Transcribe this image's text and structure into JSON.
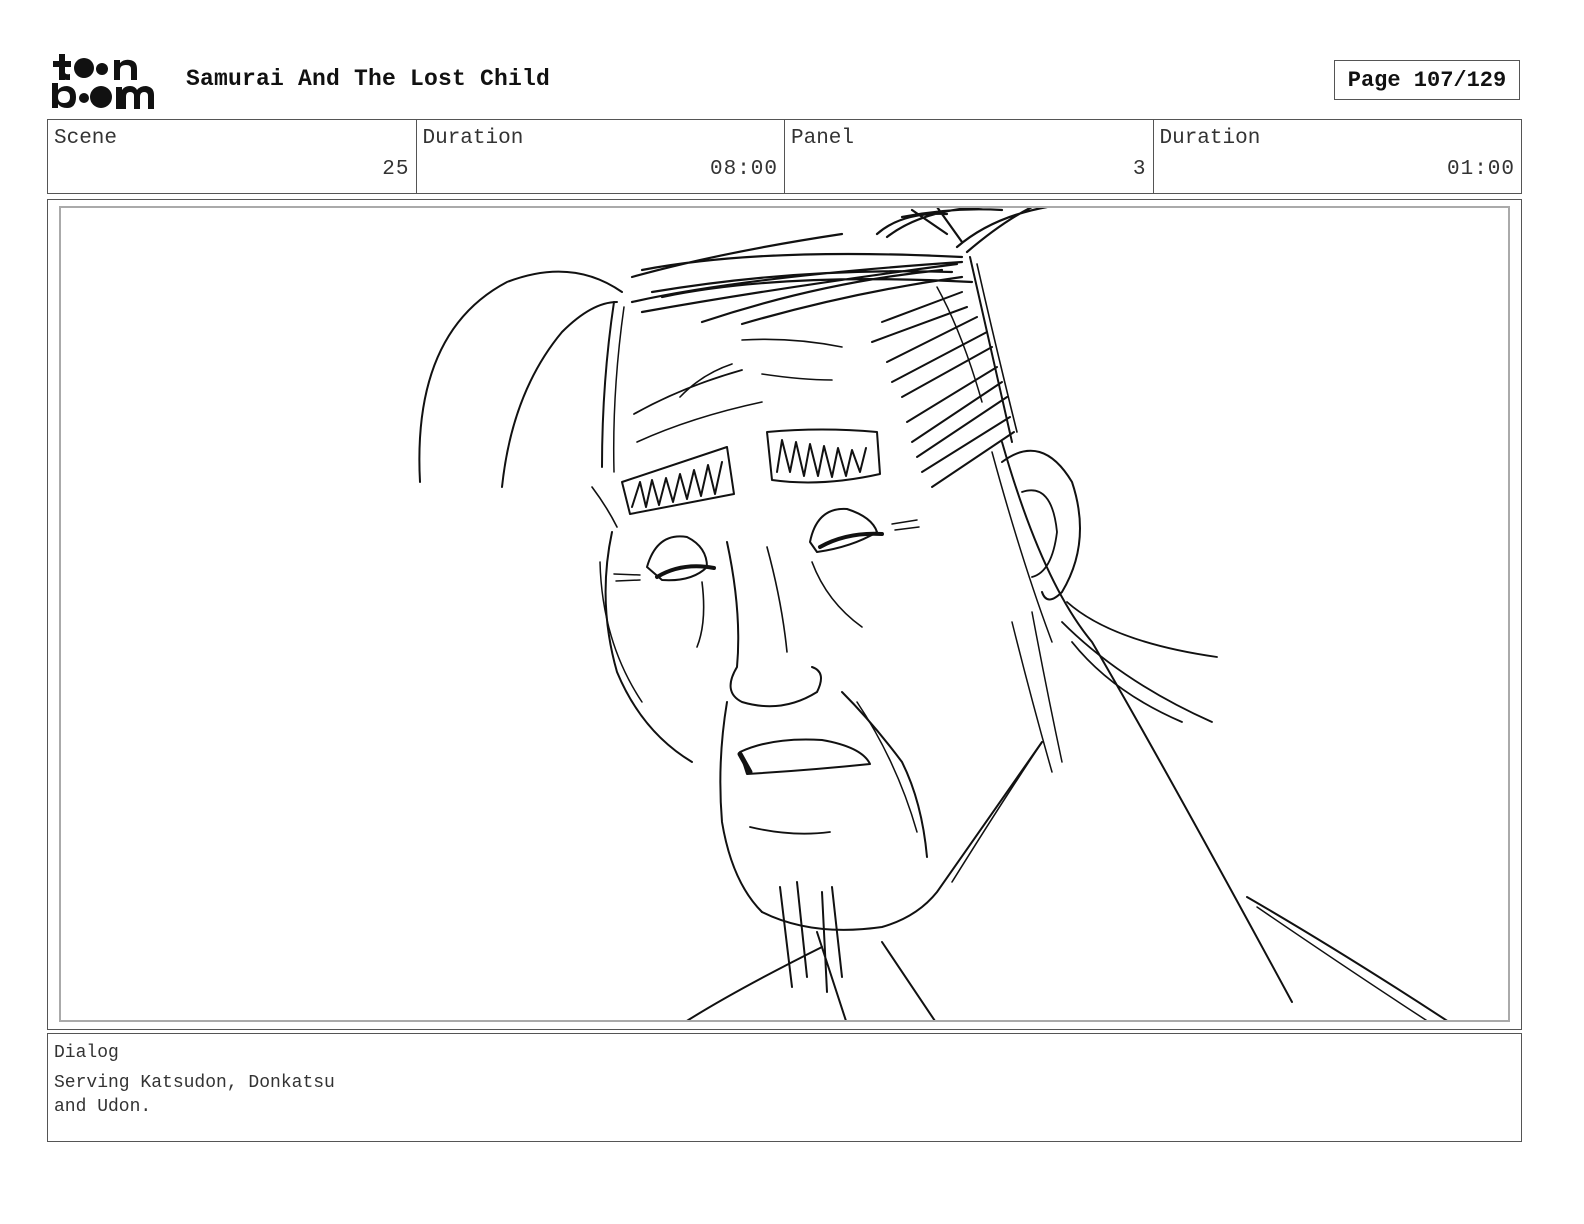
{
  "logo": {
    "text": "toon boom",
    "icon": "toon-boom-logo"
  },
  "header": {
    "title": "Samurai And The Lost Child",
    "page": "Page 107/129"
  },
  "info": {
    "scene_label": "Scene",
    "scene_value": "25",
    "scene_duration_label": "Duration",
    "scene_duration_value": "08:00",
    "panel_label": "Panel",
    "panel_value": "3",
    "panel_duration_label": "Duration",
    "panel_duration_value": "01:00"
  },
  "panel": {
    "image": "storyboard-sketch-samurai-face"
  },
  "dialog": {
    "label": "Dialog",
    "text": "Serving Katsudon, Donkatsu\nand Udon."
  }
}
